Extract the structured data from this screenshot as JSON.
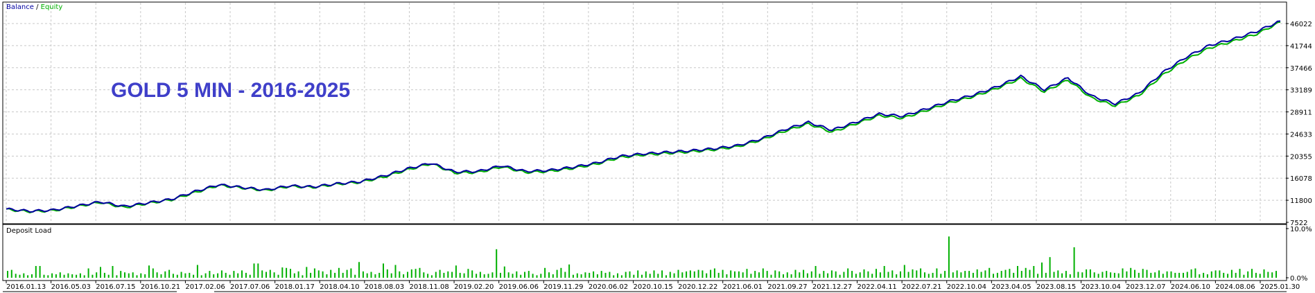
{
  "legend": {
    "balance": "Balance",
    "separator": " / ",
    "equity": "Equity"
  },
  "annotation": "GOLD 5 MIN - 2016-2025",
  "colors": {
    "balance": "#0000a0",
    "equity": "#00b000",
    "bars": "#00b000",
    "grid": "#c8c8c8",
    "annotation": "#3f3fc9"
  },
  "chart_data": [
    {
      "type": "line",
      "title": "",
      "legend_entries": [
        "Balance",
        "Equity"
      ],
      "legend_position": "top-left",
      "grid": true,
      "ylim": [
        7522,
        48000
      ],
      "y_ticks": [
        "46022",
        "41744",
        "37466",
        "33189",
        "28911",
        "24633",
        "20355",
        "16078",
        "11800",
        "7522"
      ],
      "x_ticks": [
        "2016.01.13",
        "2016.05.03",
        "2016.07.15",
        "2016.10.21",
        "2017.02.06",
        "2017.07.06",
        "2018.01.17",
        "2018.04.10",
        "2018.08.03",
        "2018.11.08",
        "2019.02.20",
        "2019.06.06",
        "2019.11.29",
        "2020.06.02",
        "2020.10.15",
        "2020.12.22",
        "2021.06.01",
        "2021.09.27",
        "2021.12.27",
        "2022.04.11",
        "2022.07.21",
        "2022.10.04",
        "2023.04.05",
        "2023.08.15",
        "2023.10.04",
        "2023.12.07",
        "2024.06.10",
        "2024.08.06",
        "2025.01.30"
      ],
      "x": [
        0,
        0.02,
        0.04,
        0.06,
        0.08,
        0.1,
        0.12,
        0.14,
        0.16,
        0.18,
        0.2,
        0.22,
        0.24,
        0.26,
        0.28,
        0.3,
        0.32,
        0.34,
        0.36,
        0.38,
        0.4,
        0.42,
        0.44,
        0.46,
        0.48,
        0.5,
        0.52,
        0.54,
        0.56,
        0.58,
        0.6,
        0.62,
        0.64,
        0.66,
        0.68,
        0.7,
        0.72,
        0.74,
        0.76,
        0.78,
        0.8,
        0.82,
        0.84,
        0.86,
        0.88,
        0.9,
        0.92,
        0.94,
        0.96,
        0.98,
        1.0
      ],
      "series": [
        {
          "name": "Balance",
          "values": [
            10100,
            9700,
            9900,
            10700,
            11500,
            10600,
            11300,
            12000,
            13500,
            14800,
            14300,
            13800,
            14600,
            14400,
            15000,
            15400,
            16500,
            17900,
            19000,
            17300,
            17400,
            18500,
            17400,
            17600,
            18200,
            19000,
            20300,
            20800,
            21100,
            21400,
            21800,
            22400,
            23700,
            25500,
            26900,
            25400,
            26900,
            28500,
            28100,
            29500,
            31000,
            32200,
            33800,
            35800,
            33200,
            35500,
            32000,
            30500,
            32500,
            36500,
            39500,
            41800,
            43000,
            44500,
            46500
          ]
        },
        {
          "name": "Equity",
          "values": [
            10000,
            9600,
            9800,
            10600,
            11400,
            10400,
            11200,
            11900,
            13300,
            14700,
            14200,
            13700,
            14500,
            14300,
            14900,
            15300,
            16300,
            17700,
            18900,
            17100,
            17200,
            18300,
            17200,
            17400,
            18000,
            18800,
            20100,
            20600,
            20900,
            21200,
            21600,
            22200,
            23500,
            25200,
            26600,
            25000,
            26600,
            28200,
            27700,
            29200,
            30700,
            31900,
            33500,
            35400,
            32800,
            35100,
            31600,
            30100,
            32100,
            36000,
            39000,
            41300,
            42600,
            44000,
            46300
          ]
        }
      ]
    },
    {
      "type": "bar",
      "title": "Deposit Load",
      "ylim": [
        0,
        10.0
      ],
      "y_ticks": [
        "10.0%",
        "0.0%"
      ],
      "values": [
        1.4,
        1.6,
        0.8,
        0.6,
        0.9,
        0.5,
        0.7,
        2.4,
        2.4,
        0.6,
        0.5,
        0.9,
        0.7,
        1.1,
        0.6,
        0.9,
        0.7,
        0.6,
        0.9,
        0.5,
        1.9,
        0.6,
        1.1,
        2.2,
        1.0,
        0.6,
        2.4,
        0.5,
        1.4,
        1.1,
        0.9,
        1.1,
        0.5,
        0.9,
        0.7,
        2.5,
        1.9,
        1.1,
        0.7,
        1.3,
        1.6,
        0.8,
        0.6,
        1.2,
        0.9,
        1.0,
        0.6,
        2.6,
        0.5,
        0.9,
        1.4,
        0.7,
        0.9,
        1.5,
        1.0,
        0.6,
        1.4,
        0.9,
        1.5,
        1.0,
        0.6,
        2.9,
        2.9,
        1.5,
        1.2,
        1.6,
        1.1,
        0.6,
        2.1,
        2.0,
        1.8,
        0.9,
        1.3,
        0.5,
        2.2,
        1.0,
        1.9,
        1.5,
        1.3,
        0.7,
        1.6,
        1.0,
        2.0,
        1.0,
        1.6,
        1.9,
        0.6,
        3.2,
        1.3,
        0.9,
        1.2,
        0.7,
        1.0,
        2.9,
        1.7,
        0.9,
        2.6,
        1.3,
        0.7,
        1.2,
        1.7,
        1.8,
        2.0,
        1.1,
        0.8,
        0.5,
        1.2,
        1.6,
        1.0,
        1.3,
        1.2,
        2.5,
        1.0,
        0.9,
        1.8,
        1.5,
        0.8,
        1.2,
        0.7,
        0.8,
        1.1,
        5.8,
        1.0,
        2.3,
        1.1,
        0.8,
        1.3,
        0.6,
        1.2,
        1.4,
        0.8,
        0.5,
        0.8,
        2.0,
        1.1,
        0.7,
        1.6,
        2.0,
        1.2,
        2.7,
        0.6,
        0.9,
        0.7,
        1.1,
        1.0,
        1.3,
        0.7,
        1.4,
        1.0,
        1.2,
        0.5,
        0.9,
        0.5,
        1.2,
        1.3,
        0.6,
        1.5,
        0.6,
        1.3,
        0.8,
        1.5,
        0.8,
        1.5,
        0.5,
        1.2,
        0.9,
        1.6,
        1.1,
        1.3,
        1.5,
        1.3,
        1.6,
        1.5,
        0.9,
        1.6,
        1.9,
        1.0,
        1.6,
        0.7,
        1.5,
        1.3,
        1.3,
        1.1,
        1.8,
        0.8,
        1.4,
        1.1,
        1.9,
        1.4,
        0.6,
        1.5,
        1.3,
        0.7,
        1.1,
        0.7,
        1.6,
        1.1,
        1.6,
        0.9,
        1.3,
        2.4,
        0.8,
        1.4,
        0.9,
        1.5,
        1.3,
        0.6,
        1.2,
        1.9,
        1.4,
        0.8,
        1.1,
        1.7,
        1.3,
        0.8,
        1.8,
        1.1,
        2.4,
        1.2,
        1.5,
        0.7,
        1.3,
        2.6,
        1.2,
        1.7,
        1.5,
        1.9,
        1.1,
        0.8,
        1.0,
        1.9,
        0.8,
        1.4,
        8.4,
        1.1,
        1.5,
        1.1,
        1.4,
        1.4,
        1.0,
        1.7,
        1.2,
        1.5,
        2.0,
        0.8,
        1.0,
        1.4,
        1.6,
        1.8,
        1.0,
        2.4,
        1.4,
        2.0,
        1.6,
        2.4,
        0.8,
        3.1,
        1.0,
        4.2,
        1.2,
        1.5,
        0.9,
        1.4,
        0.7,
        6.2,
        1.2,
        1.1,
        1.7,
        1.7,
        1.1,
        0.8,
        1.2,
        1.4,
        1.1,
        1.0,
        0.9,
        1.9,
        1.3,
        2.0,
        1.6,
        1.0,
        1.8,
        1.6,
        1.0,
        1.1,
        1.5,
        0.8,
        1.3,
        1.3,
        1.0,
        1.0,
        1.0,
        1.2,
        1.7,
        1.9,
        0.7,
        1.0,
        0.7,
        1.3,
        1.5,
        1.5,
        1.0,
        0.8,
        1.6,
        1.0,
        1.8,
        0.6,
        1.3,
        1.8,
        1.0,
        0.8,
        1.7,
        1.2,
        1.1,
        1.4
      ]
    }
  ]
}
